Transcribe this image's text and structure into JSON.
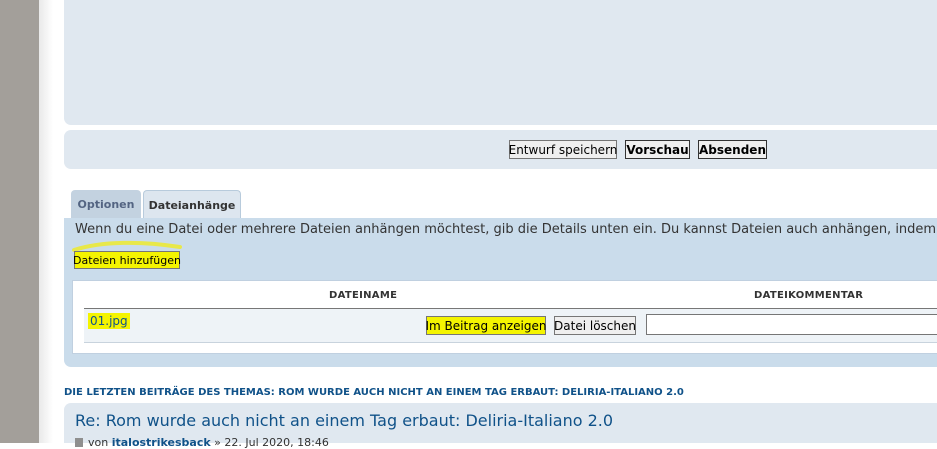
{
  "buttons": {
    "save_draft": "Entwurf speichern",
    "preview": "Vorschau",
    "submit": "Absenden"
  },
  "tabs": [
    {
      "label": "Optionen"
    },
    {
      "label": "Dateianhänge"
    }
  ],
  "attachments": {
    "hint": "Wenn du eine Datei oder mehrere Dateien anhängen möchtest, gib die Details unten ein. Du kannst Dateien auch anhängen, indem du sie mit",
    "add_files_label": "Dateien hinzufügen",
    "columns": {
      "filename": "DATEINAME",
      "comment": "DATEIKOMMENTAR"
    },
    "files": [
      {
        "name": "01.jpg",
        "show_in_post_label": "Im Beitrag anzeigen",
        "delete_label": "Datei löschen",
        "comment": ""
      }
    ]
  },
  "topic_review": {
    "heading": "DIE LETZTEN BEITRÄGE DES THEMAS: ROM WURDE AUCH NICHT AN EINEM TAG ERBAUT: DELIRIA-ITALIANO 2.0",
    "post_title": "Re: Rom wurde auch nicht an einem Tag erbaut: Deliria-Italiano 2.0",
    "post_by": "von",
    "post_author": "italostrikesback",
    "post_date": "» 22. Jul 2020, 18:46"
  },
  "colors": {
    "highlight": "#f4f400",
    "panel": "#e0e8f0",
    "attach_panel": "#cadceb",
    "link": "#105289"
  }
}
